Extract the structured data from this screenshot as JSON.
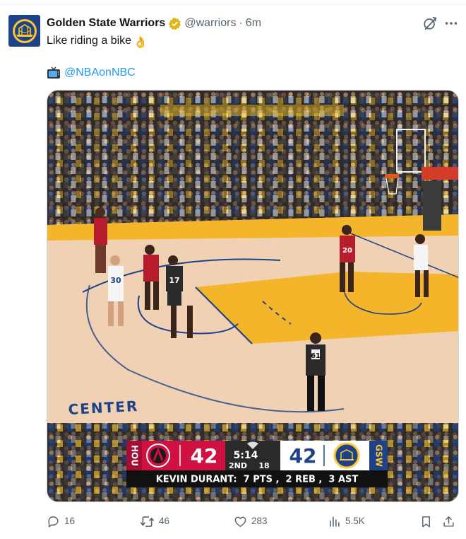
{
  "tweet": {
    "author_name": "Golden State Warriors",
    "handle": "@warriors",
    "separator": "·",
    "time": "6m",
    "text": "Like riding a bike",
    "text_emoji": "👌",
    "mention": "@NBAonNBC",
    "icons": {
      "avatar": "warriors-logo",
      "verified": "gold-checkmark-badge",
      "grok": "grok-icon",
      "more": "more-dots-icon",
      "tv": "tv-emoji"
    }
  },
  "video": {
    "arena_sign": "CENTER",
    "jerseys": [
      "30",
      "17",
      "20",
      "61"
    ],
    "scoreboard": {
      "home_abbr": "HOU",
      "home_score": "42",
      "away_score": "42",
      "away_abbr": "GSW",
      "clock": "5:14",
      "quarter": "2ND",
      "shot_clock": "18",
      "stat_line": "KEVIN DURANT:  7 PTS ,  2 REB ,  3 AST"
    },
    "colors": {
      "court": "#f0d1b3",
      "paint": "#f5b52a",
      "houston_red": "#ce1141",
      "warriors_blue": "#1d428a",
      "warriors_gold": "#ffc72c"
    }
  },
  "stats": {
    "replies": "16",
    "reposts": "46",
    "likes": "283",
    "views": "5.5K"
  },
  "action_icons": [
    "reply-icon",
    "repost-icon",
    "like-icon",
    "views-icon",
    "bookmark-icon",
    "share-icon"
  ]
}
